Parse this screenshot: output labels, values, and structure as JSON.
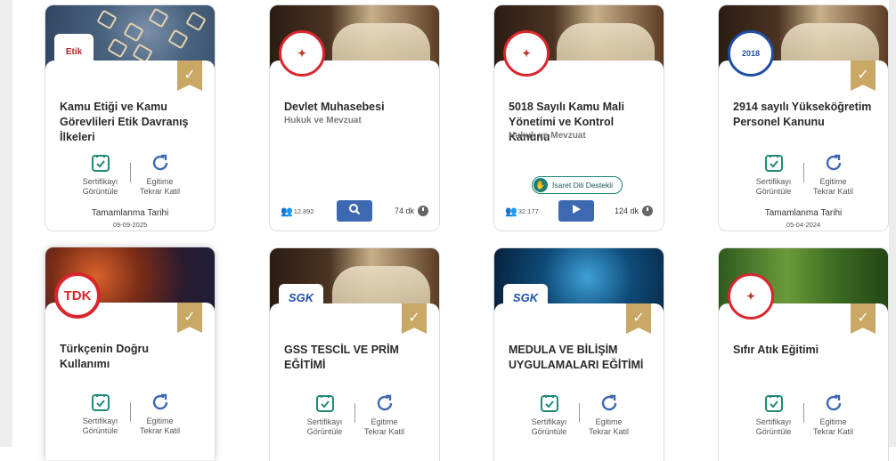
{
  "labels": {
    "certificate": [
      "Sertifikayı",
      "Görüntüle"
    ],
    "retake": [
      "Egitime",
      "Tekrar Katil"
    ],
    "completion": "Tamamlanma Tarihi",
    "sign_language": "İsaret Dili Destekli"
  },
  "colors": {
    "ribbon": "#c9a765",
    "action_icon": "#1f8a78",
    "retake_icon": "#3d69b2",
    "play_button": "#3d69b2"
  },
  "icons": {
    "ribbon": "check-ribbon-icon",
    "certificate": "certificate-check-icon",
    "retake": "refresh-icon",
    "users": "users-icon",
    "search": "search-icon",
    "play": "play-icon",
    "clock": "clock-icon",
    "sign": "sign-language-icon"
  },
  "cards": [
    {
      "title": "Kamu Etiği ve Kamu Görevlileri Etik Davranış İlkeleri",
      "logo": "Etik",
      "completed_date": "09-09-2025"
    },
    {
      "title": "Devlet Muhasebesi",
      "subtitle": "Hukuk ve Mevzuat",
      "participants": "12.892",
      "duration": "74 dk"
    },
    {
      "title": "5018 Sayılı Kamu Mali Yönetimi ve Kontrol Kanunu",
      "subtitle": "Hukuk ve Mevzuat",
      "participants": "32.177",
      "duration": "124 dk"
    },
    {
      "title": "2914 sayılı Yükseköğretim Personel Kanunu",
      "logo": "2018",
      "completed_date": "05-04-2024"
    },
    {
      "title": "Türkçenin Doğru Kullanımı",
      "logo": "TDK"
    },
    {
      "title": "GSS TESCİL VE PRİM EĞİTİMİ",
      "logo": "SGK"
    },
    {
      "title": "MEDULA VE BİLİŞİM UYGULAMALARI EĞİTİMİ",
      "logo": "SGK"
    },
    {
      "title": "Sıfır Atık Eğitimi"
    }
  ]
}
